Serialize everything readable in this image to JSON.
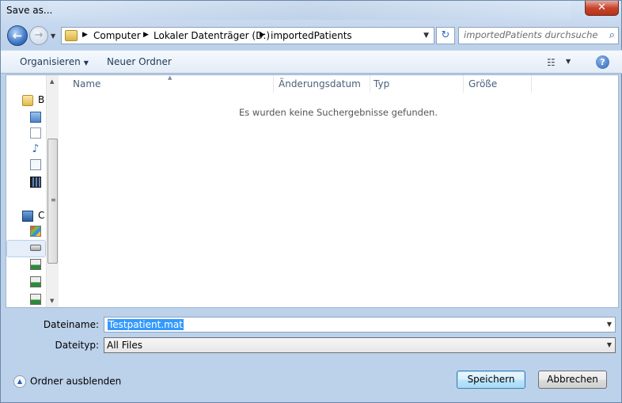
{
  "window": {
    "title": "Save as..."
  },
  "nav": {
    "breadcrumb": [
      "Computer",
      "Lokaler Datenträger (D:)",
      "importedPatients"
    ],
    "search_placeholder": "importedPatients durchsuchen"
  },
  "toolbar": {
    "organize_label": "Organisieren",
    "new_folder_label": "Neuer Ordner"
  },
  "sidebar": {
    "items": [
      {
        "icon": "libraries-icon",
        "label": "B"
      },
      {
        "icon": "pictures-icon",
        "label": ""
      },
      {
        "icon": "documents-icon",
        "label": ""
      },
      {
        "icon": "music-icon",
        "label": ""
      },
      {
        "icon": "documents2-icon",
        "label": ""
      },
      {
        "icon": "videos-icon",
        "label": ""
      },
      {
        "icon": "computer-icon",
        "label": "C"
      },
      {
        "icon": "windows-drive-icon",
        "label": ""
      },
      {
        "icon": "drive-icon",
        "label": ""
      },
      {
        "icon": "network-drive-icon",
        "label": ""
      },
      {
        "icon": "network-drive-icon",
        "label": ""
      },
      {
        "icon": "network-drive-icon",
        "label": ""
      }
    ]
  },
  "columns": [
    "Name",
    "Änderungsdatum",
    "Typ",
    "Größe"
  ],
  "empty_message": "Es wurden keine Suchergebnisse gefunden.",
  "form": {
    "filename_label": "Dateiname:",
    "filename_value": "Testpatient.mat",
    "filetype_label": "Dateityp:",
    "filetype_value": "All Files"
  },
  "footer": {
    "hide_folders_label": "Ordner ausblenden",
    "save_label": "Speichern",
    "cancel_label": "Abbrechen"
  }
}
